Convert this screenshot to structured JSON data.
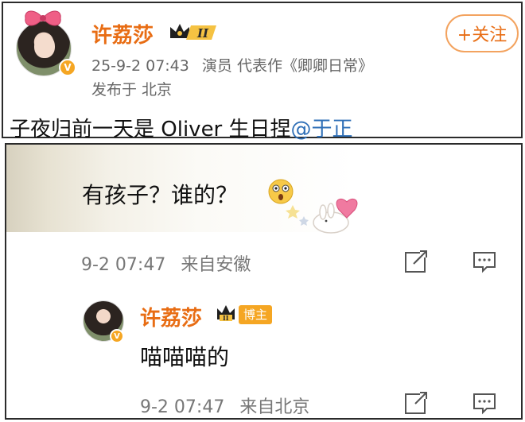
{
  "post": {
    "username": "许荔莎",
    "level_label": "II",
    "follow_label": "+关注",
    "date": "25-9-2 07:43",
    "role": "演员 代表作《卿卿日常》",
    "location": "发布于 北京",
    "text": "子夜归前一天是 Oliver 生日捏",
    "mention": "@于正"
  },
  "comment": {
    "text": "有孩子？谁的？",
    "emoji": "astonished-face",
    "time": "9-2 07:47",
    "source": "来自安徽"
  },
  "reply": {
    "username": "许荔莎",
    "badge": "博主",
    "text": "喵喵喵的",
    "time": "9-2 07:47",
    "source": "来自北京"
  },
  "colors": {
    "name_orange": "#e86d14",
    "mention_blue": "#2f6fb7",
    "badge_orange": "#f5a623"
  }
}
